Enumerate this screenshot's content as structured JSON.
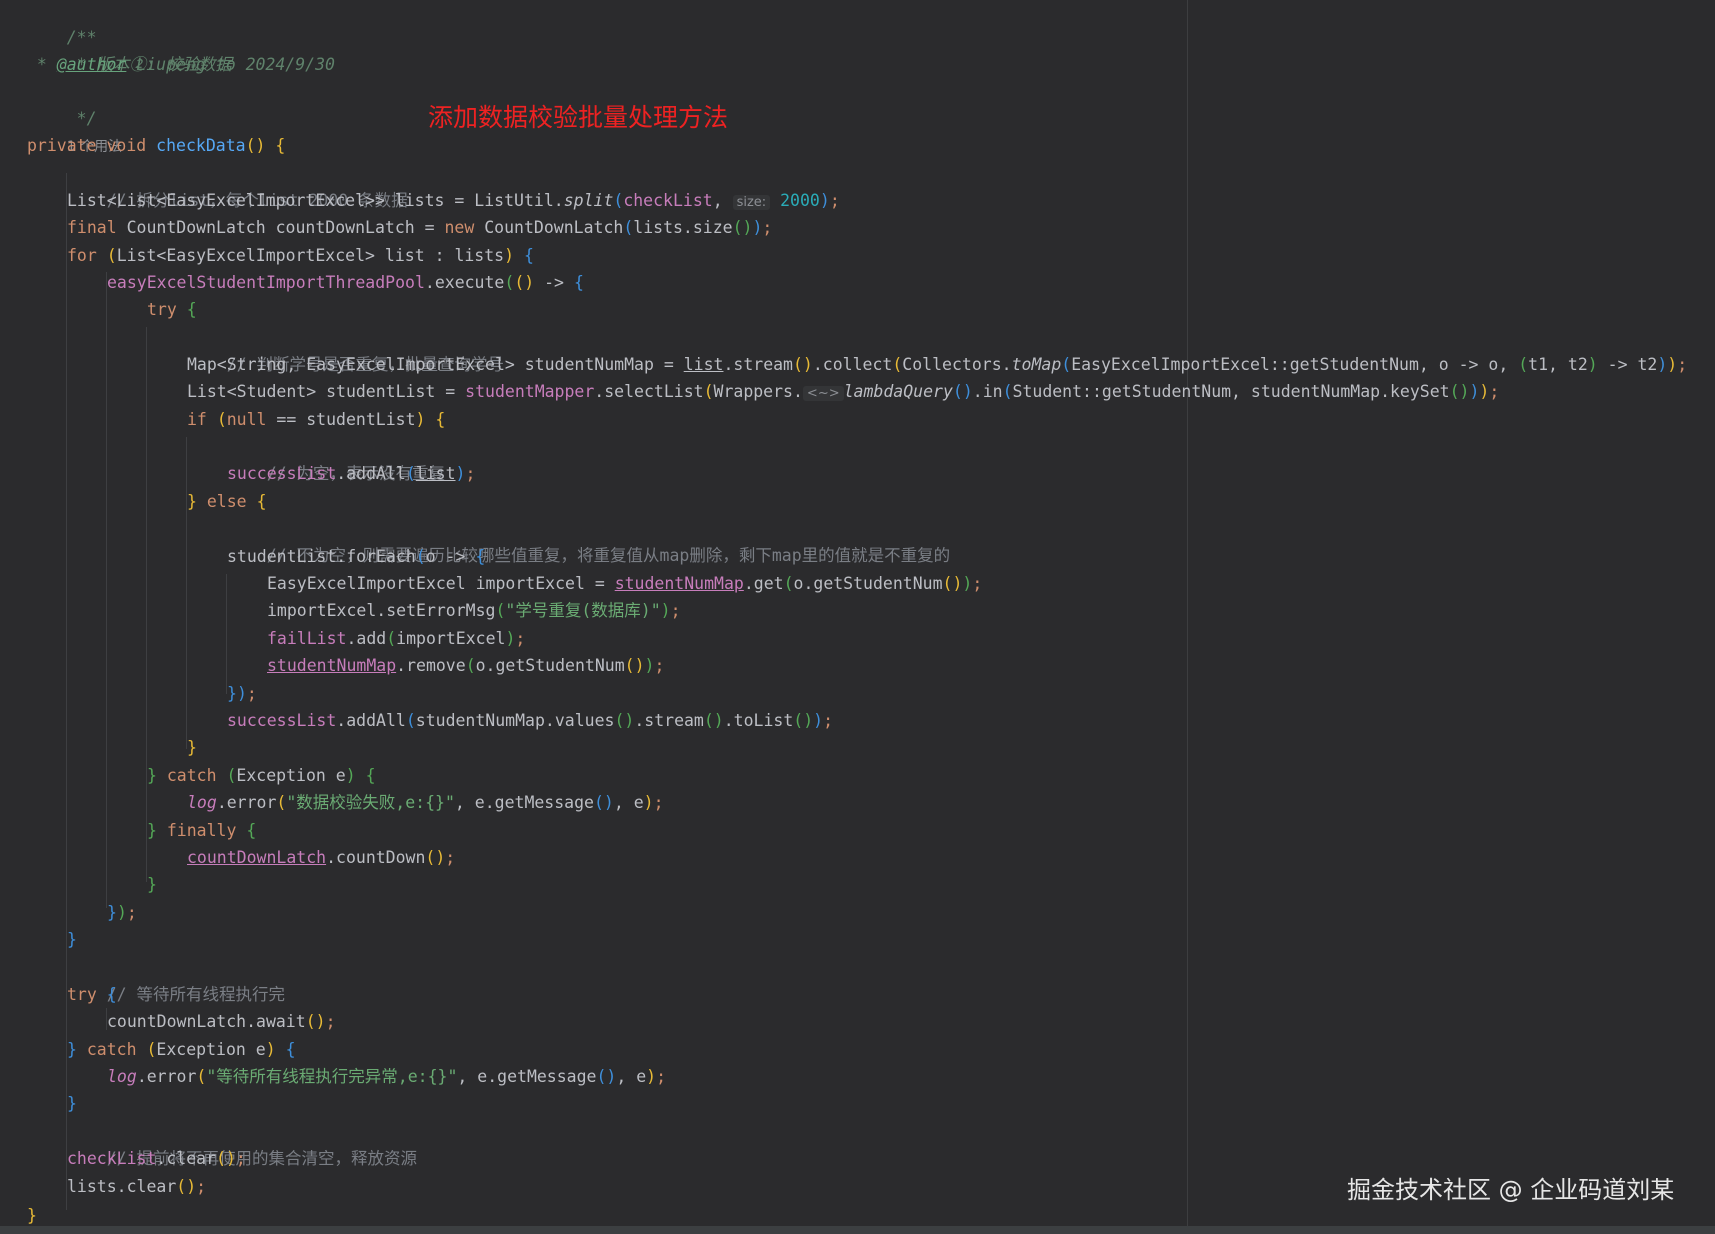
{
  "annotation_text": "添加数据校验批量处理方法",
  "watermark_text": "掘金技术社区 @ 企业码道刘某",
  "code": {
    "doc_open": "/**",
    "doc_version": " * 版本②: 校验数据",
    "doc_star": " * ",
    "doc_author_tag": "@author",
    "doc_author_rest": " Liupeng to 2024/9/30",
    "doc_close": " */",
    "usage_hint": "1 个用法",
    "kw_private": "private",
    "kw_void": "void",
    "kw_final": "final",
    "kw_new": "new",
    "kw_for": "for",
    "kw_try": "try",
    "kw_if": "if",
    "kw_null": "null",
    "kw_else": "else",
    "kw_catch": "catch",
    "kw_finally": "finally",
    "method_checkData": "checkData",
    "cmt_split": "// 拆分list，每个list 2000 条数据",
    "cmt_check_dup": "// 判断学号是否重复，批量查询学号",
    "cmt_empty": "// 为空，表示没有重复",
    "cmt_not_empty": "// 不为空，则需要遍历比较哪些值重复，将重复值从map删除，剩下map里的值就是不重复的",
    "cmt_wait": "// 等待所有线程执行完",
    "cmt_release": "// 提前将不再使用的集合清空，释放资源",
    "t_list_list": "List<List<EasyExcelImportExcel>> lists = ListUtil.",
    "m_split": "split",
    "f_checkList": "checkList",
    "hint_size": "size:",
    "n_2000": "2000",
    "t_cdl_decl": " CountDownLatch countDownLatch = ",
    "t_cdl_ctor": " CountDownLatch",
    "t_lists_size": "lists.size",
    "t_for_decl": "List<EasyExcelImportExcel> list : lists",
    "f_pool": "easyExcelStudentImportThreadPool",
    "t_execute": ".execute",
    "t_arrow": " -> ",
    "t_map_decl": "Map<String, EasyExcelImportExcel> studentNumMap = ",
    "t_list": "list",
    "t_stream": ".stream",
    "t_collect": ".collect",
    "t_collectors": "Collectors.",
    "m_toMap": "toMap",
    "t_tomap_args": "EasyExcelImportExcel::getStudentNum, o -> o, ",
    "t_t1t2": "t1, t2",
    "t_t2": " -> t2",
    "t_student_list": "List<Student> studentList = ",
    "f_mapper": "studentMapper",
    "t_select": ".selectList",
    "t_wrappers": "Wrappers.",
    "t_diamond": "<~>",
    "m_lambda": "lambdaQuery",
    "t_in": ".in",
    "t_in_args": "Student::getStudentNum, studentNumMap.keySet",
    "t_eq_student": " == studentList",
    "f_success": "successList",
    "t_addAll": ".addAll",
    "t_foreach": "studentList.forEach",
    "t_o": "o",
    "t_import_decl": "EasyExcelImportExcel importExcel = ",
    "f_studentNumMap": "studentNumMap",
    "t_get": ".get",
    "t_getnum": "o.getStudentNum",
    "t_seterr": "importExcel.setErrorMsg",
    "s_dup": "\"学号重复(数据库)\"",
    "f_fail": "failList",
    "t_add": ".add",
    "t_importExcel": "importExcel",
    "t_remove": ".remove",
    "t_values": "studentNumMap.values",
    "t_tolist": ".toList",
    "t_exception": "Exception e",
    "f_log": "log",
    "t_error": ".error",
    "s_fail": "\"数据校验失败,e:{}\"",
    "t_getmsg": ", e.getMessage",
    "t_e": ", e",
    "f_cdl": "countDownLatch",
    "t_countdown": ".countDown",
    "t_await": "countDownLatch.await",
    "s_wait_err": "\"等待所有线程执行完异常,e:{}\"",
    "t_clear": ".clear",
    "t_lists": "lists"
  }
}
